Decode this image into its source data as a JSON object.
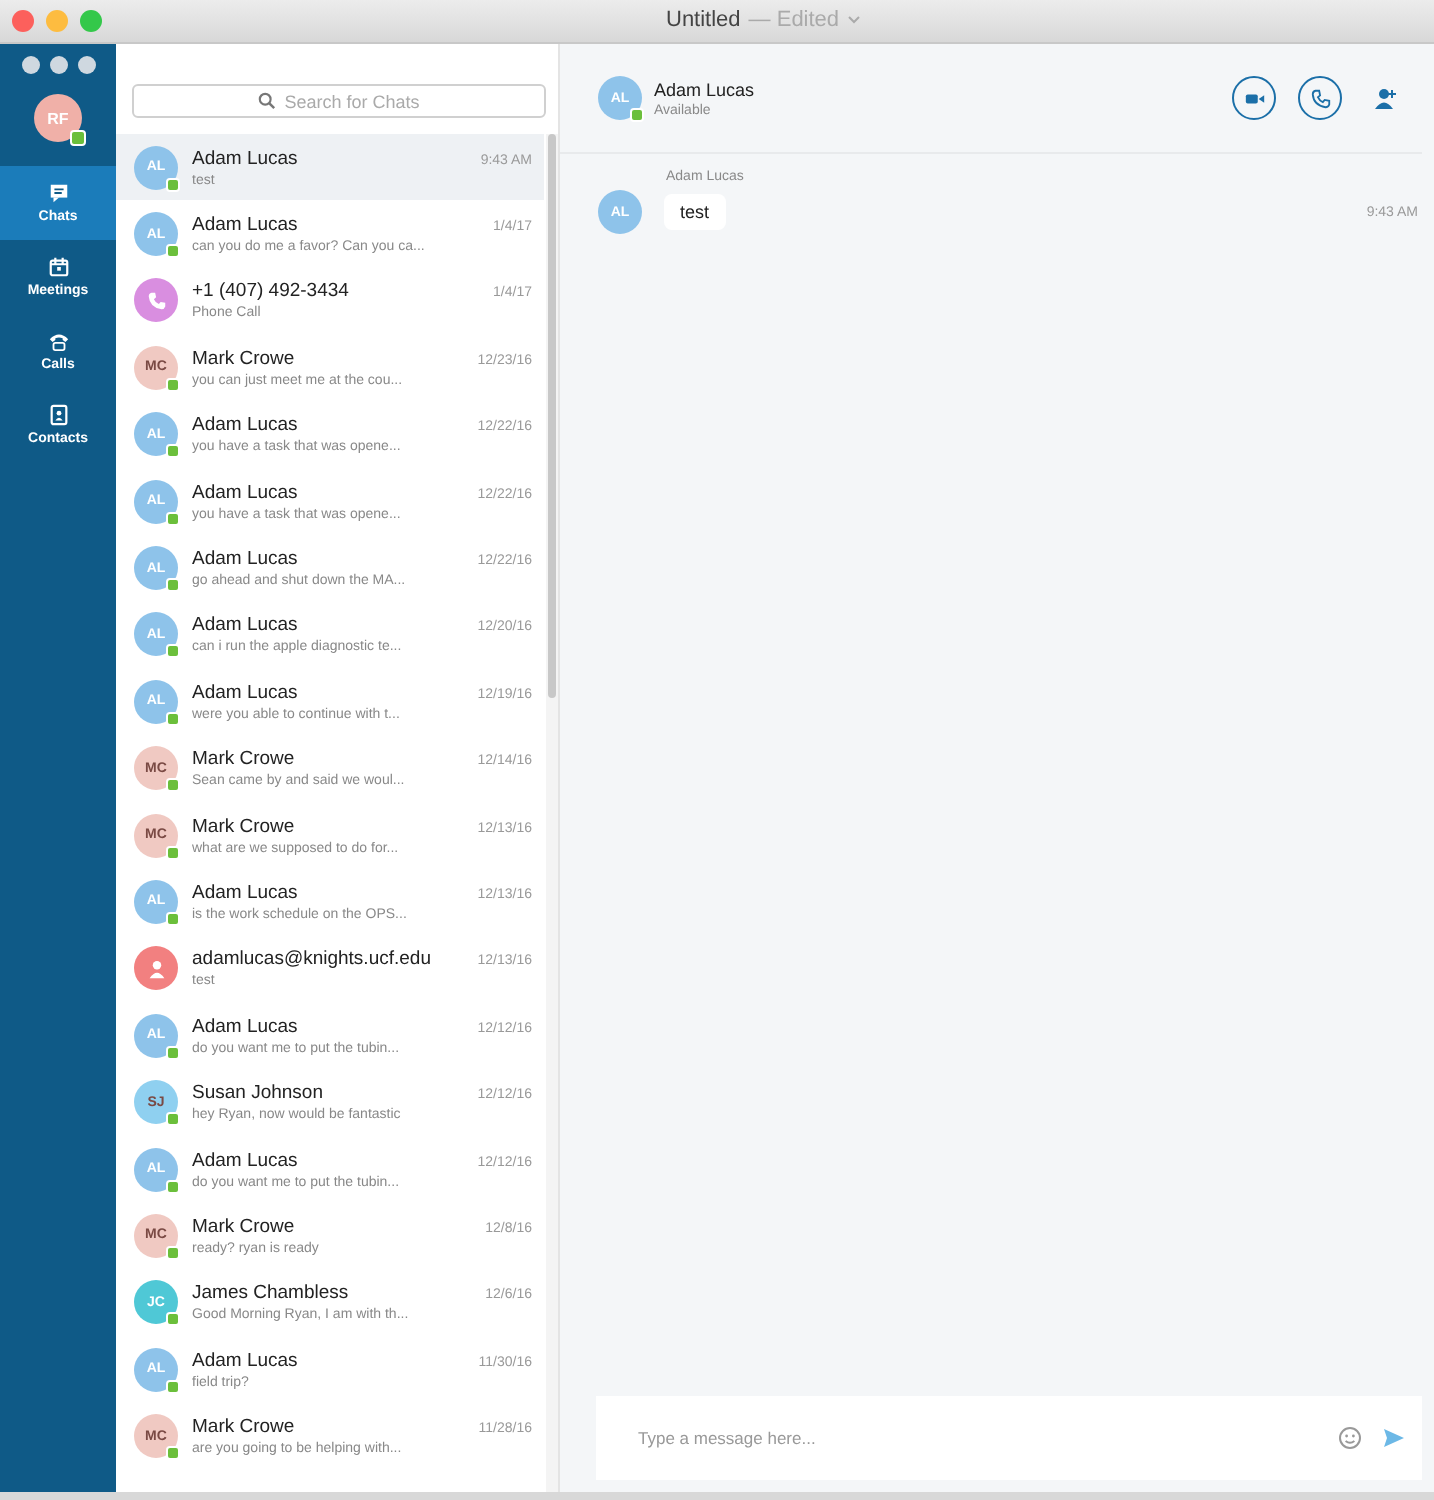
{
  "window": {
    "title": "Untitled",
    "subtitle": "— Edited"
  },
  "sidebar": {
    "user": {
      "initials": "RF",
      "online": true
    },
    "items": [
      {
        "label": "Chats",
        "selected": true
      },
      {
        "label": "Meetings",
        "selected": false
      },
      {
        "label": "Calls",
        "selected": false
      },
      {
        "label": "Contacts",
        "selected": false
      }
    ]
  },
  "search": {
    "placeholder": "Search for Chats"
  },
  "chats": [
    {
      "kind": "initials",
      "initials": "AL",
      "color": "#8ec3ea",
      "online": true,
      "name": "Adam Lucas",
      "preview": "test",
      "time": "9:43 AM",
      "selected": true
    },
    {
      "kind": "initials",
      "initials": "AL",
      "color": "#8ec3ea",
      "online": true,
      "name": "Adam Lucas",
      "preview": "can you do me a favor? Can you ca...",
      "time": "1/4/17",
      "selected": false
    },
    {
      "kind": "phone",
      "color": "#d98ee0",
      "online": false,
      "name": "+1 (407) 492-3434",
      "preview": "Phone Call",
      "time": "1/4/17",
      "selected": false
    },
    {
      "kind": "initials",
      "initials": "MC",
      "color": "#f0c9c2",
      "online": true,
      "name": "Mark Crowe",
      "preview": "you can just meet me at the cou...",
      "time": "12/23/16",
      "selected": false
    },
    {
      "kind": "initials",
      "initials": "AL",
      "color": "#8ec3ea",
      "online": true,
      "name": "Adam Lucas",
      "preview": "you have a task that was opene...",
      "time": "12/22/16",
      "selected": false
    },
    {
      "kind": "initials",
      "initials": "AL",
      "color": "#8ec3ea",
      "online": true,
      "name": "Adam Lucas",
      "preview": "you have a task that was opene...",
      "time": "12/22/16",
      "selected": false
    },
    {
      "kind": "initials",
      "initials": "AL",
      "color": "#8ec3ea",
      "online": true,
      "name": "Adam Lucas",
      "preview": "go ahead and shut down the MA...",
      "time": "12/22/16",
      "selected": false
    },
    {
      "kind": "initials",
      "initials": "AL",
      "color": "#8ec3ea",
      "online": true,
      "name": "Adam Lucas",
      "preview": "can i run the apple diagnostic te...",
      "time": "12/20/16",
      "selected": false
    },
    {
      "kind": "initials",
      "initials": "AL",
      "color": "#8ec3ea",
      "online": true,
      "name": "Adam Lucas",
      "preview": "were you able to continue with t...",
      "time": "12/19/16",
      "selected": false
    },
    {
      "kind": "initials",
      "initials": "MC",
      "color": "#f0c9c2",
      "online": true,
      "name": "Mark Crowe",
      "preview": "Sean came by and said we woul...",
      "time": "12/14/16",
      "selected": false
    },
    {
      "kind": "initials",
      "initials": "MC",
      "color": "#f0c9c2",
      "online": true,
      "name": "Mark Crowe",
      "preview": "what are we supposed to do for...",
      "time": "12/13/16",
      "selected": false
    },
    {
      "kind": "initials",
      "initials": "AL",
      "color": "#8ec3ea",
      "online": true,
      "name": "Adam Lucas",
      "preview": "is the work schedule on the OPS...",
      "time": "12/13/16",
      "selected": false
    },
    {
      "kind": "person",
      "color": "#f28080",
      "online": false,
      "name": "adamlucas@knights.ucf.edu",
      "preview": "test",
      "time": "12/13/16",
      "selected": false
    },
    {
      "kind": "initials",
      "initials": "AL",
      "color": "#8ec3ea",
      "online": true,
      "name": "Adam Lucas",
      "preview": "do you want me to put the tubin...",
      "time": "12/12/16",
      "selected": false
    },
    {
      "kind": "initials",
      "initials": "SJ",
      "color": "#8fd0f0",
      "online": true,
      "name": "Susan Johnson",
      "preview": "hey Ryan, now would be fantastic",
      "time": "12/12/16",
      "selected": false
    },
    {
      "kind": "initials",
      "initials": "AL",
      "color": "#8ec3ea",
      "online": true,
      "name": "Adam Lucas",
      "preview": "do you want me to put the tubin...",
      "time": "12/12/16",
      "selected": false
    },
    {
      "kind": "initials",
      "initials": "MC",
      "color": "#f0c9c2",
      "online": true,
      "name": "Mark Crowe",
      "preview": "ready? ryan is ready",
      "time": "12/8/16",
      "selected": false
    },
    {
      "kind": "initials",
      "initials": "JC",
      "color": "#4fc8d6",
      "online": true,
      "name": "James Chambless",
      "preview": "Good Morning Ryan, I am with th...",
      "time": "12/6/16",
      "selected": false
    },
    {
      "kind": "initials",
      "initials": "AL",
      "color": "#8ec3ea",
      "online": true,
      "name": "Adam Lucas",
      "preview": "field trip?",
      "time": "11/30/16",
      "selected": false
    },
    {
      "kind": "initials",
      "initials": "MC",
      "color": "#f0c9c2",
      "online": true,
      "name": "Mark Crowe",
      "preview": "are you going to be helping with...",
      "time": "11/28/16",
      "selected": false
    }
  ],
  "conversation": {
    "contact": {
      "initials": "AL",
      "name": "Adam Lucas",
      "status": "Available",
      "online": true
    },
    "messages": [
      {
        "sender": "Adam Lucas",
        "initials": "AL",
        "text": "test",
        "time": "9:43 AM"
      }
    ],
    "composer": {
      "placeholder": "Type a message here..."
    }
  }
}
